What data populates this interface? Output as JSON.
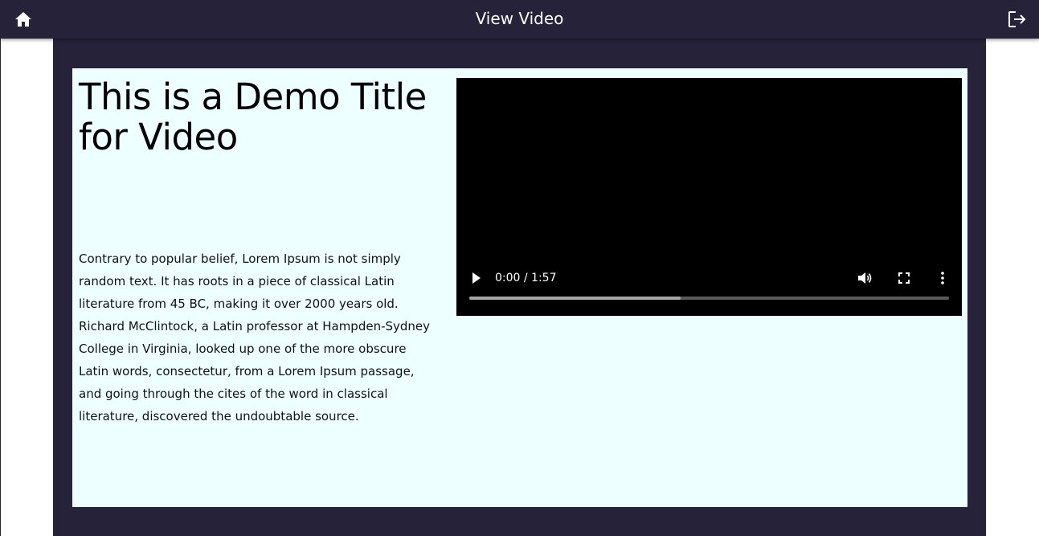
{
  "appbar": {
    "title": "View Video",
    "home_icon": "home-icon",
    "logout_icon": "logout-icon",
    "background": "#25223a"
  },
  "video": {
    "title": "This is a Demo Title for Video",
    "description": "Contrary to popular belief, Lorem Ipsum is not simply random text. It has roots in a piece of classical Latin literature from 45 BC, making it over 2000 years old. Richard McClintock, a Latin professor at Hampden-Sydney College in Virginia, looked up one of the more obscure Latin words, consectetur, from a Lorem Ipsum passage, and going through the cites of the word in classical literature, discovered the undoubtable source.",
    "player": {
      "time_display": "0:00 / 1:57",
      "buffered_fraction": 0.44,
      "play_icon": "play-icon",
      "volume_icon": "volume-icon",
      "fullscreen_icon": "fullscreen-icon",
      "more_icon": "more-vert-icon"
    }
  },
  "colors": {
    "card_background": "#eeffff",
    "frame": "#25223a"
  }
}
